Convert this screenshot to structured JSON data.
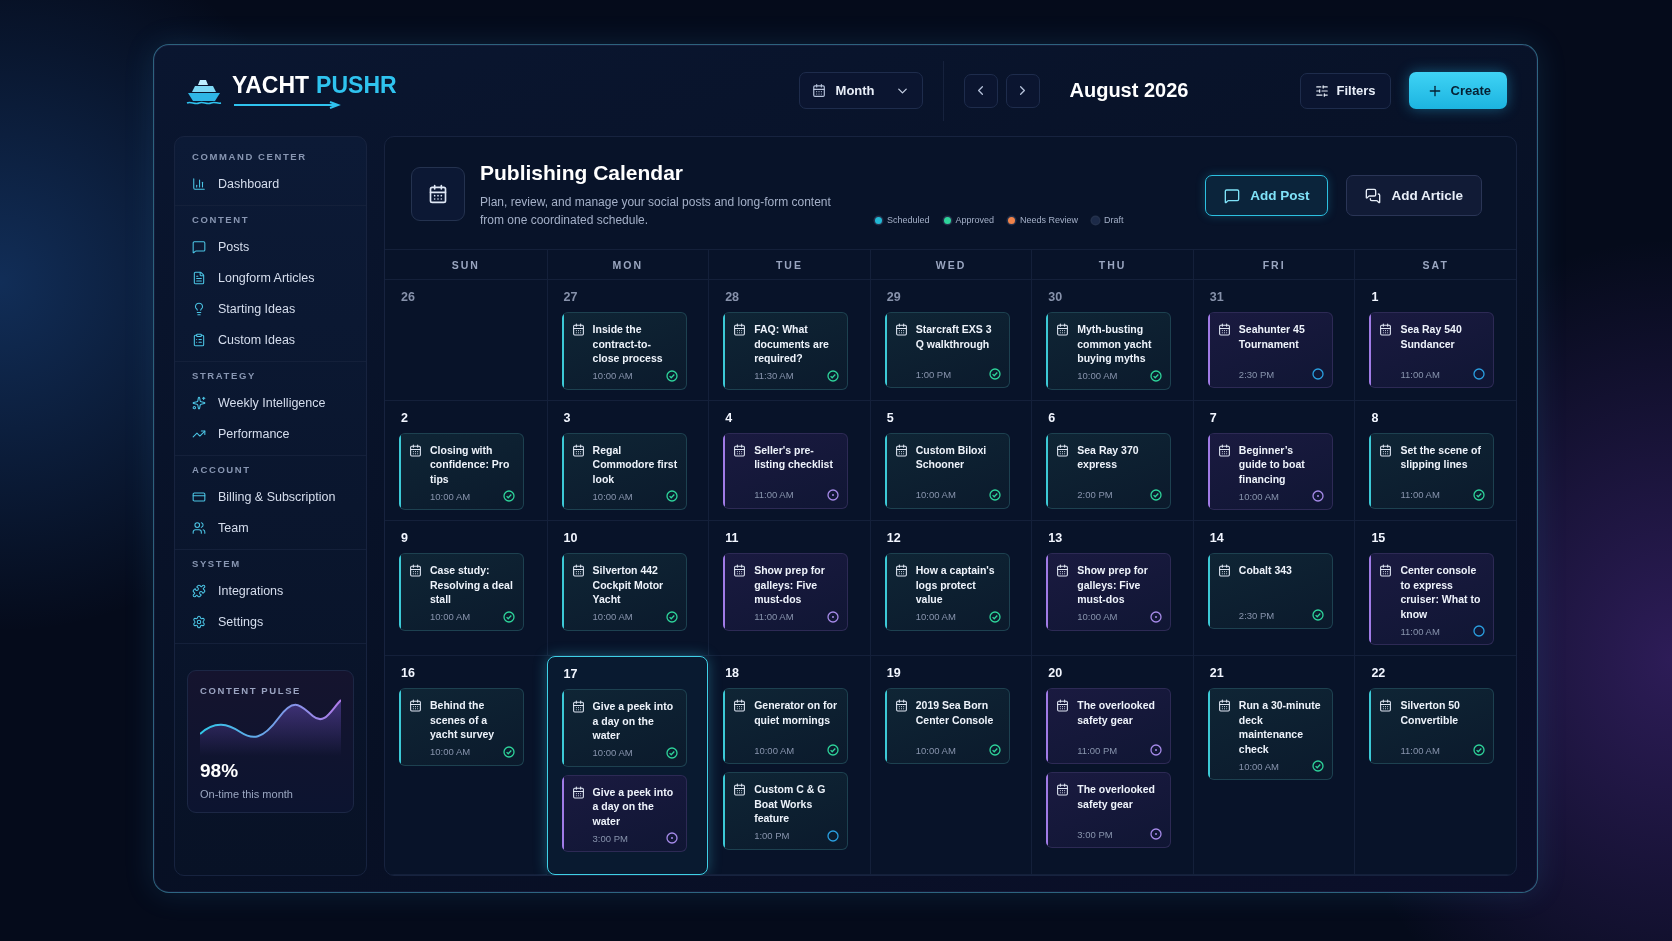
{
  "logo": {
    "primary": "YACHT",
    "accent": "PUSHR"
  },
  "toolbar": {
    "view": "Month",
    "period": "August 2026",
    "filters": "Filters",
    "create": "Create"
  },
  "sidebar": {
    "sections": [
      {
        "label": "COMMAND CENTER",
        "items": [
          {
            "label": "Dashboard",
            "kind": "chart",
            "selected": false
          }
        ]
      },
      {
        "label": "CONTENT",
        "items": [
          {
            "label": "Posts",
            "kind": "message",
            "selected": false
          },
          {
            "label": "Longform Articles",
            "kind": "file",
            "selected": false
          },
          {
            "label": "Starting Ideas",
            "kind": "bulb",
            "selected": false
          },
          {
            "label": "Custom Ideas",
            "kind": "list",
            "selected": false
          }
        ]
      },
      {
        "label": "STRATEGY",
        "items": [
          {
            "label": "Weekly Intelligence",
            "kind": "sparkles",
            "selected": false
          },
          {
            "label": "Performance",
            "kind": "trend",
            "selected": false
          }
        ]
      },
      {
        "label": "ACCOUNT",
        "items": [
          {
            "label": "Billing & Subscription",
            "kind": "card",
            "selected": false
          },
          {
            "label": "Team",
            "kind": "users",
            "selected": false
          }
        ]
      },
      {
        "label": "SYSTEM",
        "items": [
          {
            "label": "Integrations",
            "kind": "puzzle",
            "selected": false
          },
          {
            "label": "Settings",
            "kind": "gear",
            "selected": false
          }
        ]
      }
    ],
    "pulse": {
      "label": "CONTENT PULSE",
      "value": "98%",
      "caption": "On-time this month"
    }
  },
  "calendar": {
    "title": "Publishing Calendar",
    "subtitle": "Plan, review, and manage your social posts and long-form content from one coordinated schedule.",
    "legend": [
      {
        "label": "Scheduled",
        "color": "#22b8d4"
      },
      {
        "label": "Approved",
        "color": "#2ed39a"
      },
      {
        "label": "Needs Review",
        "color": "#f0834a"
      },
      {
        "label": "Draft",
        "color": "#1c2a48"
      }
    ],
    "actions": [
      "Add Post",
      "Add Article"
    ],
    "weekdays": [
      "SUN",
      "MON",
      "TUE",
      "WED",
      "THU",
      "FRI",
      "SAT"
    ],
    "days": [
      {
        "date": "26",
        "muted": true,
        "selected": false
      },
      {
        "date": "27",
        "muted": true,
        "selected": false,
        "posts": [
          {
            "title": "Inside the contract-to-close process",
            "time": "10:00 AM",
            "kind": "approved",
            "color": "#3cc9d6"
          }
        ]
      },
      {
        "date": "28",
        "muted": true,
        "selected": false,
        "posts": [
          {
            "title": "FAQ: What documents are required?",
            "time": "11:30 AM",
            "kind": "approved",
            "color": "#3cc9d6"
          }
        ]
      },
      {
        "date": "29",
        "muted": true,
        "selected": false,
        "posts": [
          {
            "title": "Starcraft EXS 3 Q walkthrough",
            "time": "1:00 PM",
            "kind": "approved",
            "color": "#3cc9d6"
          }
        ]
      },
      {
        "date": "30",
        "muted": true,
        "selected": false,
        "posts": [
          {
            "title": "Myth-busting common yacht buying myths",
            "time": "10:00 AM",
            "kind": "approved",
            "color": "#3cc9d6"
          }
        ]
      },
      {
        "date": "31",
        "muted": true,
        "selected": false,
        "posts": [
          {
            "title": "Seahunter 45 Tournament",
            "time": "2:30 PM",
            "kind": "scheduled",
            "color": "#a07be6"
          }
        ]
      },
      {
        "date": "1",
        "muted": false,
        "selected": false,
        "posts": [
          {
            "title": "Sea Ray 540 Sundancer",
            "time": "11:00 AM",
            "kind": "scheduled",
            "color": "#a07be6"
          }
        ]
      },
      {
        "date": "2",
        "muted": false,
        "selected": false,
        "posts": [
          {
            "title": "Closing with confidence: Pro tips",
            "time": "10:00 AM",
            "kind": "approved",
            "color": "#3cc9d6"
          }
        ]
      },
      {
        "date": "3",
        "muted": false,
        "selected": false,
        "posts": [
          {
            "title": "Regal Commodore first look",
            "time": "10:00 AM",
            "kind": "approved",
            "color": "#3cc9d6"
          }
        ]
      },
      {
        "date": "4",
        "muted": false,
        "selected": false,
        "posts": [
          {
            "title": "Seller's pre-listing checklist",
            "time": "11:00 AM",
            "kind": "draft",
            "color": "#a07be6"
          }
        ]
      },
      {
        "date": "5",
        "muted": false,
        "selected": false,
        "posts": [
          {
            "title": "Custom Biloxi Schooner",
            "time": "10:00 AM",
            "kind": "approved",
            "color": "#3cc9d6"
          }
        ]
      },
      {
        "date": "6",
        "muted": false,
        "selected": false,
        "posts": [
          {
            "title": "Sea Ray 370 express",
            "time": "2:00 PM",
            "kind": "approved",
            "color": "#3cc9d6"
          }
        ]
      },
      {
        "date": "7",
        "muted": false,
        "selected": false,
        "posts": [
          {
            "title": "Beginner’s guide to boat financing",
            "time": "10:00 AM",
            "kind": "draft",
            "color": "#a07be6"
          }
        ]
      },
      {
        "date": "8",
        "muted": false,
        "selected": false,
        "posts": [
          {
            "title": "Set the scene of slipping lines",
            "time": "11:00 AM",
            "kind": "approved",
            "color": "#3cc9d6"
          }
        ]
      },
      {
        "date": "9",
        "muted": false,
        "selected": false,
        "posts": [
          {
            "title": "Case study: Resolving a deal stall",
            "time": "10:00 AM",
            "kind": "approved",
            "color": "#3cc9d6"
          }
        ]
      },
      {
        "date": "10",
        "muted": false,
        "selected": false,
        "posts": [
          {
            "title": "Silverton 442 Cockpit Motor Yacht",
            "time": "10:00 AM",
            "kind": "approved",
            "color": "#3cc9d6"
          }
        ]
      },
      {
        "date": "11",
        "muted": false,
        "selected": false,
        "posts": [
          {
            "title": "Show prep for galleys: Five must-dos",
            "time": "11:00 AM",
            "kind": "draft",
            "color": "#a07be6"
          }
        ]
      },
      {
        "date": "12",
        "muted": false,
        "selected": false,
        "posts": [
          {
            "title": "How a captain's logs protect value",
            "time": "10:00 AM",
            "kind": "approved",
            "color": "#3cc9d6"
          }
        ]
      },
      {
        "date": "13",
        "muted": false,
        "selected": false,
        "posts": [
          {
            "title": "Show prep for galleys: Five must-dos",
            "time": "10:00 AM",
            "kind": "draft",
            "color": "#a07be6"
          }
        ]
      },
      {
        "date": "14",
        "muted": false,
        "selected": false,
        "posts": [
          {
            "title": "Cobalt 343",
            "time": "2:30 PM",
            "kind": "approved",
            "color": "#3cc9d6"
          }
        ]
      },
      {
        "date": "15",
        "muted": false,
        "selected": false,
        "posts": [
          {
            "title": "Center console to express cruiser: What to know",
            "time": "11:00 AM",
            "kind": "scheduled",
            "color": "#a07be6"
          }
        ]
      },
      {
        "date": "16",
        "muted": false,
        "selected": false,
        "posts": [
          {
            "title": "Behind the scenes of a yacht survey",
            "time": "10:00 AM",
            "kind": "approved",
            "color": "#3cc9d6"
          }
        ]
      },
      {
        "date": "17",
        "muted": false,
        "selected": true,
        "posts": [
          {
            "title": "Give a peek into a day on the water",
            "time": "10:00 AM",
            "kind": "approved",
            "color": "#3cc9d6"
          },
          {
            "title": "Give a peek into a day on the water",
            "time": "3:00 PM",
            "kind": "draft",
            "color": "#a07be6"
          }
        ]
      },
      {
        "date": "18",
        "muted": false,
        "selected": false,
        "posts": [
          {
            "title": "Generator on for quiet mornings",
            "time": "10:00 AM",
            "kind": "approved",
            "color": "#3cc9d6"
          },
          {
            "title": "Custom C & G Boat Works feature",
            "time": "1:00 PM",
            "kind": "scheduled",
            "color": "#3cc9d6"
          }
        ]
      },
      {
        "date": "19",
        "muted": false,
        "selected": false,
        "posts": [
          {
            "title": "2019 Sea Born Center Console",
            "time": "10:00 AM",
            "kind": "approved",
            "color": "#3cc9d6"
          }
        ]
      },
      {
        "date": "20",
        "muted": false,
        "selected": false,
        "posts": [
          {
            "title": "The overlooked safety gear",
            "time": "11:00 PM",
            "kind": "draft",
            "color": "#a07be6"
          },
          {
            "title": "The overlooked safety gear",
            "time": "3:00 PM",
            "kind": "draft",
            "color": "#a07be6"
          }
        ]
      },
      {
        "date": "21",
        "muted": false,
        "selected": false,
        "posts": [
          {
            "title": "Run a 30-minute deck maintenance check",
            "time": "10:00 AM",
            "kind": "approved",
            "color": "#3cc9d6"
          }
        ]
      },
      {
        "date": "22",
        "muted": false,
        "selected": false,
        "posts": [
          {
            "title": "Silverton 50 Convertible",
            "time": "11:00 AM",
            "kind": "approved",
            "color": "#3cc9d6"
          }
        ]
      }
    ]
  }
}
